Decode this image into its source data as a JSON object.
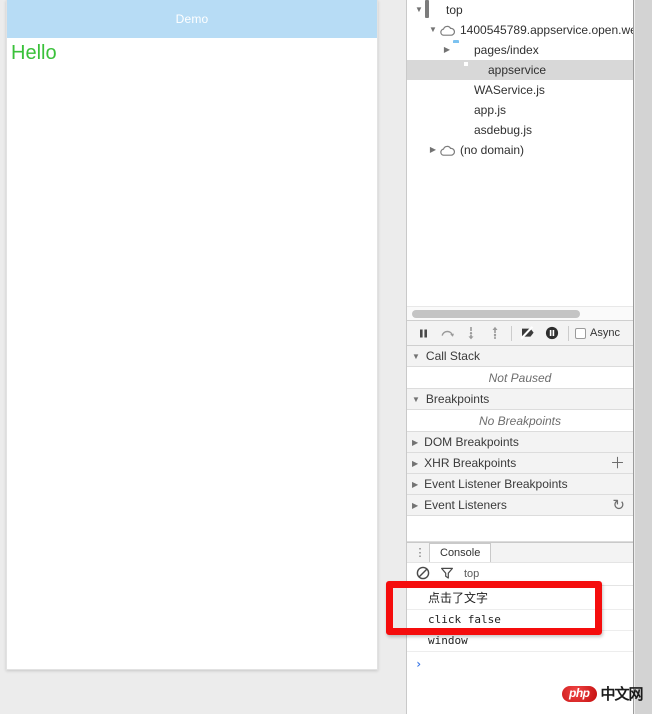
{
  "demo": {
    "title": "Demo",
    "body_text": "Hello",
    "header_bg": "#b7dcf5",
    "text_color": "#3ac13a"
  },
  "devtools": {
    "navigator": {
      "tree": [
        {
          "label": "top",
          "icon": "frame-icon",
          "twisty": "▼",
          "depth": 0,
          "selected": false
        },
        {
          "label": "1400545789.appservice.open.we",
          "icon": "cloud-icon",
          "twisty": "▼",
          "depth": 1,
          "selected": false
        },
        {
          "label": "pages/index",
          "icon": "folder-icon",
          "twisty": "▶",
          "depth": 2,
          "selected": false
        },
        {
          "label": "appservice",
          "icon": "document-gray-icon",
          "twisty": "",
          "depth": 3,
          "selected": true
        },
        {
          "label": "WAService.js",
          "icon": "document-js-icon",
          "twisty": "",
          "depth": 2,
          "selected": false
        },
        {
          "label": "app.js",
          "icon": "document-js-icon",
          "twisty": "",
          "depth": 2,
          "selected": false
        },
        {
          "label": "asdebug.js",
          "icon": "document-js-icon",
          "twisty": "",
          "depth": 2,
          "selected": false
        },
        {
          "label": "(no domain)",
          "icon": "cloud-icon",
          "twisty": "▶",
          "depth": 1,
          "selected": false
        }
      ]
    },
    "debug_toolbar": {
      "buttons": [
        {
          "name": "pause-resume-button",
          "glyph": "pause"
        },
        {
          "name": "step-over-button",
          "glyph": "step-over"
        },
        {
          "name": "step-into-button",
          "glyph": "step-into"
        },
        {
          "name": "step-out-button",
          "glyph": "step-out"
        },
        {
          "name": "deactivate-breakpoints-button",
          "glyph": "deactivate"
        },
        {
          "name": "pause-on-exceptions-button",
          "glyph": "pause-circle"
        }
      ],
      "async_label": "Async"
    },
    "sections": [
      {
        "name": "call-stack",
        "label": "Call Stack",
        "twisty": "▼",
        "empty_text": "Not Paused",
        "action": ""
      },
      {
        "name": "breakpoints",
        "label": "Breakpoints",
        "twisty": "▼",
        "empty_text": "No Breakpoints",
        "action": ""
      },
      {
        "name": "dom-breakpoints",
        "label": "DOM Breakpoints",
        "twisty": "▶",
        "empty_text": "",
        "action": ""
      },
      {
        "name": "xhr-breakpoints",
        "label": "XHR Breakpoints",
        "twisty": "▶",
        "empty_text": "",
        "action": "＋"
      },
      {
        "name": "event-listener-breakpoints",
        "label": "Event Listener Breakpoints",
        "twisty": "▶",
        "empty_text": "",
        "action": ""
      },
      {
        "name": "event-listeners",
        "label": "Event Listeners",
        "twisty": "▶",
        "empty_text": "",
        "action": "↻"
      }
    ],
    "drawer": {
      "menu_glyph": "⋮",
      "tabs": [
        {
          "label": "Console",
          "active": true
        }
      ]
    },
    "console": {
      "clear_icon": "clear-console-icon",
      "filter_icon": "filter-icon",
      "context": "top",
      "messages": [
        {
          "text": "点击了文字",
          "cjk": true
        },
        {
          "text": "click false",
          "cjk": false
        },
        {
          "text": "window",
          "cjk": false
        }
      ],
      "prompt_caret": "›"
    }
  },
  "annotation": {
    "shape": "rectangle",
    "color": "#f50d0d"
  },
  "watermark": {
    "badge": "php",
    "text": "中文网"
  }
}
